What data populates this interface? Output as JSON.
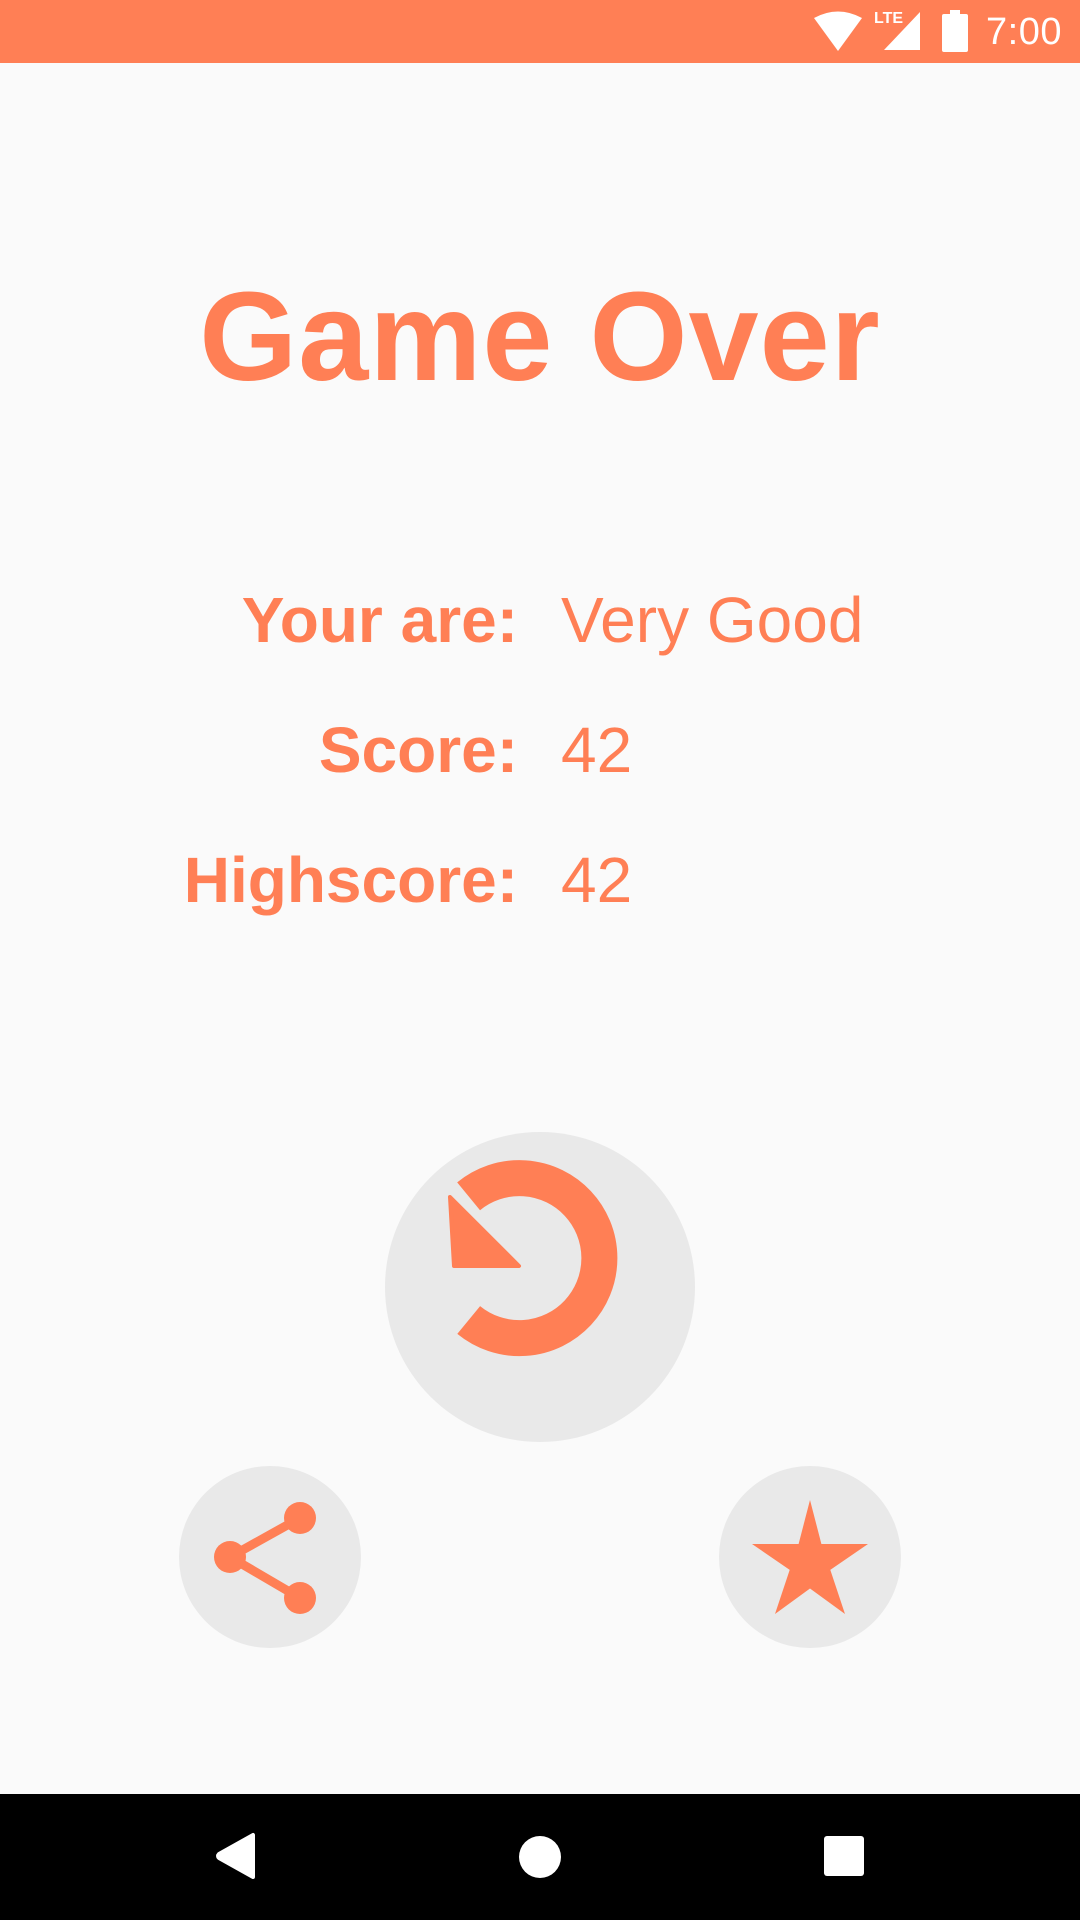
{
  "status_bar": {
    "time": "7:00",
    "network_label": "LTE",
    "icons": [
      "wifi-icon",
      "cell-signal-icon",
      "battery-icon"
    ],
    "color": "#ff7f55"
  },
  "game_over": {
    "title": "Game Over",
    "stats": [
      {
        "label": "Your are:",
        "value": "Very Good"
      },
      {
        "label": "Score:",
        "value": "42"
      },
      {
        "label": "Highscore:",
        "value": "42"
      }
    ]
  },
  "actions": {
    "replay_icon": "replay-icon",
    "share_icon": "share-icon",
    "rate_icon": "star-icon"
  },
  "nav_bar": {
    "icons": [
      "back-icon",
      "home-icon",
      "recents-icon"
    ]
  },
  "theme": {
    "accent": "#ff7f55",
    "button_bg": "#e9e9e9",
    "background": "#fafafa"
  }
}
